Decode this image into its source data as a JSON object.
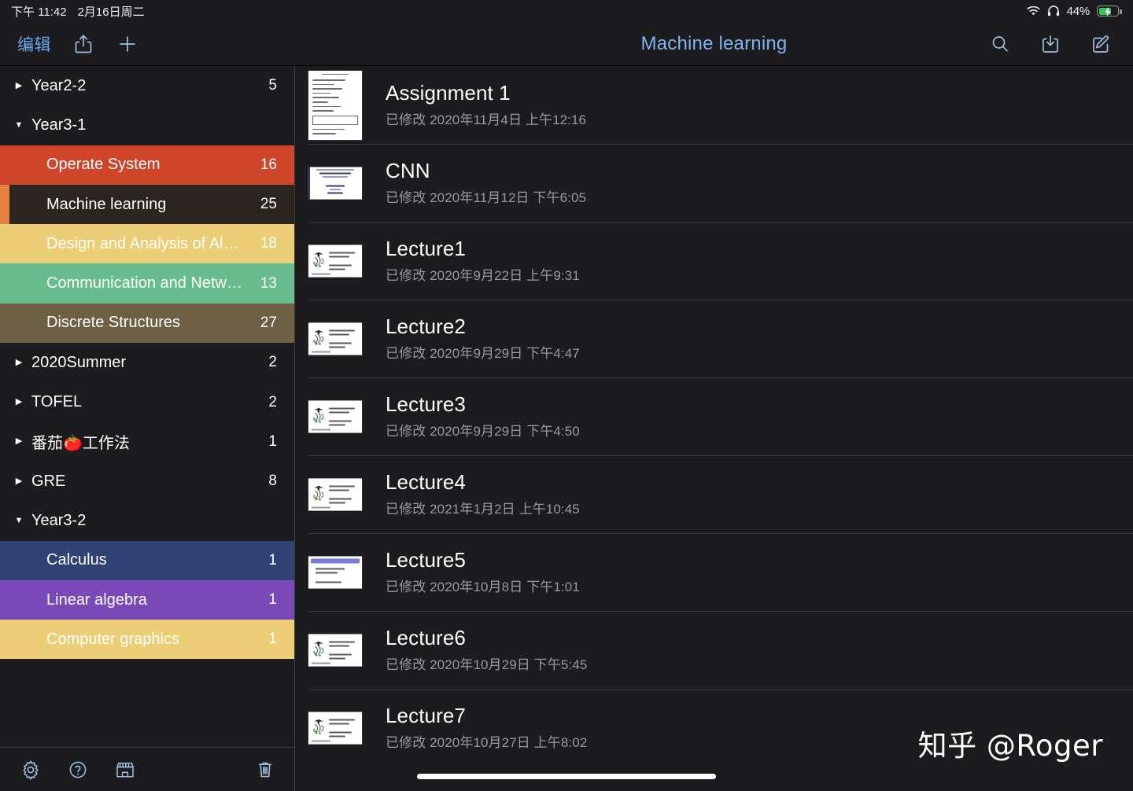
{
  "status_bar": {
    "time": "下午 11:42",
    "date": "2月16日周二",
    "wifi_icon": "wifi-icon",
    "headphones_icon": "headphones-icon",
    "battery_percent": "44%",
    "battery_icon": "battery-charging-icon",
    "battery_level": 44
  },
  "nav_bar": {
    "edit_label": "编辑",
    "share_icon": "share-icon",
    "add_icon": "plus-icon",
    "title": "Machine learning",
    "search_icon": "search-icon",
    "import_icon": "import-download-icon",
    "compose_icon": "compose-icon"
  },
  "sidebar": {
    "rows": [
      {
        "type": "group",
        "label": "Year2-2",
        "count": "5",
        "expanded": false,
        "caret": "▶"
      },
      {
        "type": "group",
        "label": "Year3-1",
        "count": "",
        "expanded": true,
        "caret": "▼"
      },
      {
        "type": "child",
        "label": "Operate System",
        "count": "16",
        "color": "#cf452a",
        "selected": false
      },
      {
        "type": "child",
        "label": "Machine learning",
        "count": "25",
        "color": "#e3823f",
        "selected": true,
        "selected_bg": "#2b2520"
      },
      {
        "type": "child",
        "label": "Design and Analysis of Al…",
        "count": "18",
        "color": "#ecce76",
        "selected": false
      },
      {
        "type": "child",
        "label": "Communication and Netw…",
        "count": "13",
        "color": "#67bd8e",
        "selected": false
      },
      {
        "type": "child",
        "label": "Discrete Structures",
        "count": "27",
        "color": "#6d6044",
        "selected": false
      },
      {
        "type": "group",
        "label": "2020Summer",
        "count": "2",
        "expanded": false,
        "caret": "▶"
      },
      {
        "type": "group",
        "label": "TOFEL",
        "count": "2",
        "expanded": false,
        "caret": "▶"
      },
      {
        "type": "group",
        "label": "番茄🍅工作法",
        "count": "1",
        "expanded": false,
        "caret": "▶"
      },
      {
        "type": "group",
        "label": "GRE",
        "count": "8",
        "expanded": false,
        "caret": "▶"
      },
      {
        "type": "group",
        "label": "Year3-2",
        "count": "",
        "expanded": true,
        "caret": "▼"
      },
      {
        "type": "child",
        "label": "Calculus",
        "count": "1",
        "color": "#2f4374",
        "selected": false
      },
      {
        "type": "child",
        "label": "Linear algebra",
        "count": "1",
        "color": "#7a49b8",
        "selected": false
      },
      {
        "type": "child",
        "label": "Computer graphics",
        "count": "1",
        "color": "#ecce76",
        "selected": false
      }
    ],
    "footer": {
      "settings_icon": "gear-icon",
      "help_icon": "question-circle-icon",
      "store_icon": "store-icon",
      "trash_icon": "trash-icon"
    }
  },
  "note_list": {
    "modified_prefix": "已修改",
    "notes": [
      {
        "title": "Assignment 1",
        "date": "已修改 2020年11月4日 上午12:16",
        "thumb": "handwritten-page"
      },
      {
        "title": "CNN",
        "date": "已修改 2020年11月12日 下午6:05",
        "thumb": "title-slide"
      },
      {
        "title": "Lecture1",
        "date": "已修改 2020年9月22日 上午9:31",
        "thumb": "lecture-slide"
      },
      {
        "title": "Lecture2",
        "date": "已修改 2020年9月29日 下午4:47",
        "thumb": "lecture-slide"
      },
      {
        "title": "Lecture3",
        "date": "已修改 2020年9月29日 下午4:50",
        "thumb": "lecture-slide"
      },
      {
        "title": "Lecture4",
        "date": "已修改 2021年1月2日 上午10:45",
        "thumb": "lecture-slide"
      },
      {
        "title": "Lecture5",
        "date": "已修改 2020年10月8日 下午1:01",
        "thumb": "banner-slide"
      },
      {
        "title": "Lecture6",
        "date": "已修改 2020年10月29日 下午5:45",
        "thumb": "lecture-slide"
      },
      {
        "title": "Lecture7",
        "date": "已修改 2020年10月27日 上午8:02",
        "thumb": "lecture-slide"
      }
    ]
  },
  "watermark": {
    "text": "知乎 @Roger"
  },
  "colors": {
    "window_bg": "#1c1c1e",
    "accent_blue": "#7fb2ef",
    "icon_blue": "#9dbede",
    "divider": "#38383a",
    "secondary_text": "#9a9a9e",
    "battery_green": "#34c759"
  }
}
